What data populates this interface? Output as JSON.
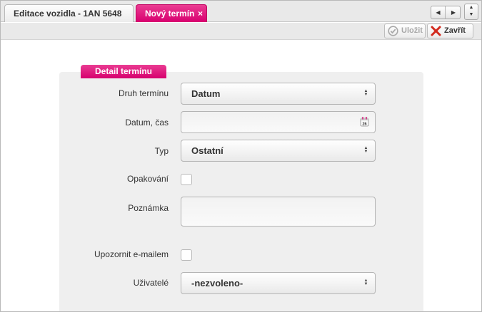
{
  "tabs": {
    "vehicle_edit": "Editace vozidla - 1AN 5648",
    "new_term": "Nový termín",
    "close_glyph": "×"
  },
  "toolbar": {
    "save_label": "Uložit",
    "close_label": "Zavřít"
  },
  "form": {
    "section_title": "Detail termínu",
    "term_type_label": "Druh termínu",
    "term_type_value": "Datum",
    "datetime_label": "Datum, čas",
    "datetime_value": "",
    "type_label": "Typ",
    "type_value": "Ostatní",
    "repeat_label": "Opakování",
    "repeat_checked": false,
    "note_label": "Poznámka",
    "note_value": "",
    "email_label": "Upozornit e-mailem",
    "email_checked": false,
    "users_label": "Uživatelé",
    "users_value": "-nezvoleno-",
    "calendar_day": "26"
  },
  "icons": {
    "save": "check-circle-icon",
    "close": "red-x-icon",
    "calendar": "calendar-icon"
  },
  "colors": {
    "accent": "#d8006f",
    "close_x": "#d22a1e",
    "save_disabled": "#a8a8a8"
  }
}
